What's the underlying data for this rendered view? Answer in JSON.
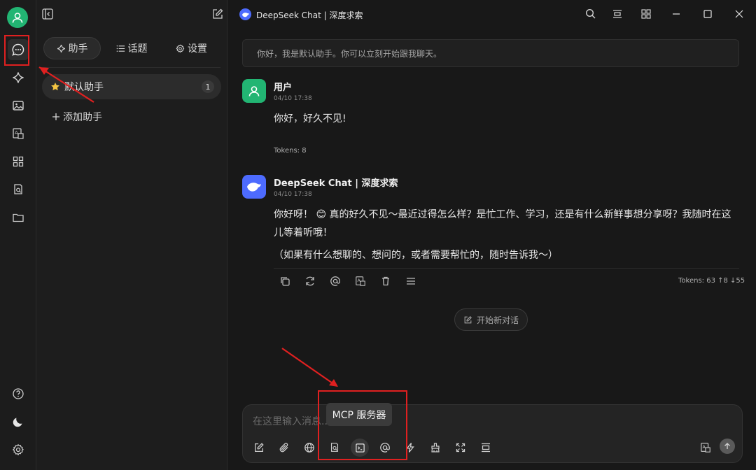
{
  "window": {
    "title": "DeepSeek Chat | 深度求索"
  },
  "sidebar_tabs": [
    {
      "icon": "sparkle-icon",
      "label": "助手"
    },
    {
      "icon": "list-icon",
      "label": "话题"
    },
    {
      "icon": "gear-icon",
      "label": "设置"
    }
  ],
  "assistants": [
    {
      "icon": "star-icon",
      "name": "默认助手",
      "count": "1"
    }
  ],
  "add_assistant_label": "添加助手",
  "system_note": "你好，我是默认助手。你可以立刻开始跟我聊天。",
  "messages": [
    {
      "role": "user",
      "author": "用户",
      "time": "04/10 17:38",
      "text": "你好，好久不见!",
      "tokens": "Tokens: 8"
    },
    {
      "role": "assistant",
      "author": "DeepSeek Chat | 深度求索",
      "time": "04/10 17:38",
      "text_line1": "你好呀！ 😊 真的好久不见～最近过得怎么样？是忙工作、学习，还是有什么新鲜事想分享呀？我随时在这",
      "text_line2": "儿等着听哦！",
      "text_p2": "（如果有什么想聊的、想问的，或者需要帮忙的，随时告诉我～）",
      "tokens": "Tokens: 63 ↑8 ↓55"
    }
  ],
  "new_chat_label": "开始新对话",
  "composer": {
    "placeholder": "在这里输入消息...",
    "tooltip": "MCP 服务器"
  },
  "colors": {
    "accent_green": "#22b573",
    "deepseek_blue": "#4d6bfe",
    "annotation_red": "#e02020"
  }
}
